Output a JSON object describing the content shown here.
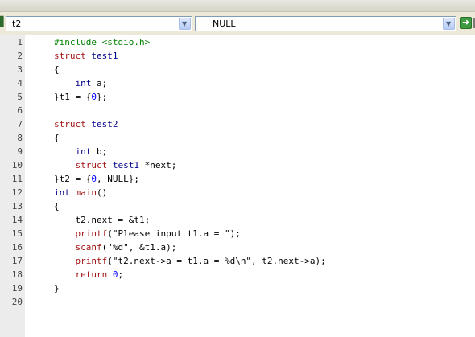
{
  "navbar": {
    "scope_value": "t2",
    "function_value": "NULL",
    "go_glyph": "➜",
    "dropdown_glyph": "▼"
  },
  "colors": {
    "keyword": "#a31515",
    "type": "#00008b",
    "preprocessor": "#008000",
    "number": "#0000ff",
    "gutter_bg": "#ececec"
  },
  "editor": {
    "line_numbers": [
      "1",
      "2",
      "3",
      "4",
      "5",
      "6",
      "7",
      "8",
      "9",
      "10",
      "11",
      "12",
      "13",
      "14",
      "15",
      "16",
      "17",
      "18",
      "19",
      "20"
    ],
    "lines": [
      [
        {
          "t": "#include <stdio.h>",
          "c": "pp"
        }
      ],
      [
        {
          "t": "struct",
          "c": "kw"
        },
        {
          "t": " "
        },
        {
          "t": "test1",
          "c": "ty"
        }
      ],
      [
        {
          "t": "{"
        }
      ],
      [
        {
          "t": "    "
        },
        {
          "t": "int",
          "c": "ty"
        },
        {
          "t": " a;"
        }
      ],
      [
        {
          "t": "}t1 = {"
        },
        {
          "t": "0",
          "c": "num"
        },
        {
          "t": "};"
        }
      ],
      [],
      [
        {
          "t": "struct",
          "c": "kw"
        },
        {
          "t": " "
        },
        {
          "t": "test2",
          "c": "ty"
        }
      ],
      [
        {
          "t": "{"
        }
      ],
      [
        {
          "t": "    "
        },
        {
          "t": "int",
          "c": "ty"
        },
        {
          "t": " b;"
        }
      ],
      [
        {
          "t": "    "
        },
        {
          "t": "struct",
          "c": "kw"
        },
        {
          "t": " "
        },
        {
          "t": "test1",
          "c": "ty"
        },
        {
          "t": " *next;"
        }
      ],
      [
        {
          "t": "}t2 = {"
        },
        {
          "t": "0",
          "c": "num"
        },
        {
          "t": ", NULL};"
        }
      ],
      [
        {
          "t": "int",
          "c": "ty"
        },
        {
          "t": " "
        },
        {
          "t": "main",
          "c": "kw"
        },
        {
          "t": "()"
        }
      ],
      [
        {
          "t": "{"
        }
      ],
      [
        {
          "t": "    t2.next = &t1;"
        }
      ],
      [
        {
          "t": "    "
        },
        {
          "t": "printf",
          "c": "kw"
        },
        {
          "t": "(\"Please input t1.a = \");"
        }
      ],
      [
        {
          "t": "    "
        },
        {
          "t": "scanf",
          "c": "kw"
        },
        {
          "t": "(\"%d\", &t1.a);"
        }
      ],
      [
        {
          "t": "    "
        },
        {
          "t": "printf",
          "c": "kw"
        },
        {
          "t": "(\"t2.next->a = t1.a = %d\\n\", t2.next->a);"
        }
      ],
      [
        {
          "t": "    "
        },
        {
          "t": "return",
          "c": "kw"
        },
        {
          "t": " "
        },
        {
          "t": "0",
          "c": "num"
        },
        {
          "t": ";"
        }
      ],
      [
        {
          "t": "}"
        }
      ],
      []
    ]
  }
}
